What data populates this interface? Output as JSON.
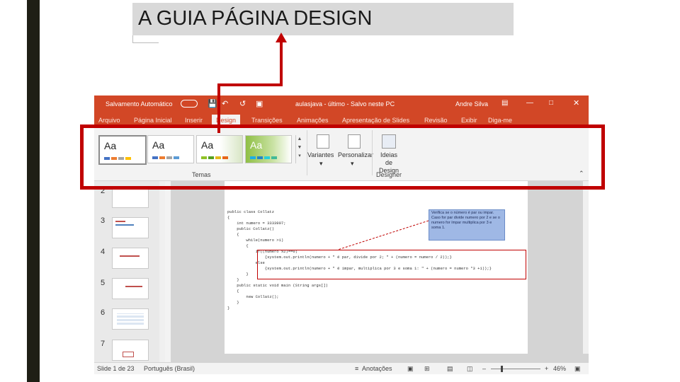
{
  "heading": {
    "text": "A GUIA PÁGINA DESIGN"
  },
  "powerpoint": {
    "titlebar": {
      "autosave": "Salvamento Automático",
      "filename": "aulasjava - último - Salvo neste PC",
      "user": "Andre Silva"
    },
    "tabs": [
      "Arquivo",
      "Página Inicial",
      "Inserir",
      "Design",
      "Transições",
      "Animações",
      "Apresentação de Slides",
      "Revisão",
      "Exibir",
      "Diga-me"
    ],
    "active_tab": "Design",
    "ribbon": {
      "themes_group_label": "Temas",
      "theme_previews": [
        "Aa",
        "Aa",
        "Aa",
        "Aa"
      ],
      "variants_label": "Variantes",
      "customize_label": "Personalizar",
      "designer_label": "Ideias de Design",
      "designer_group_label": "Designer"
    },
    "thumbnails": [
      "2",
      "3",
      "4",
      "5",
      "6",
      "7"
    ],
    "slide": {
      "code_lines": [
        "public class Collatz",
        "{",
        "    int numero = 3333997;",
        "    public Collatz()",
        "    {",
        "        while(numero >1)",
        "        {",
        "            if((numero %2)==0)",
        "                {system.out.println(numero + \" é par, divide por 2; \" + (numero = numero / 2));}",
        "            else",
        "                {system.out.println(numero + \" é impar, multiplica por 3 e soma 1: \" + (numero = numero *3 +1));}",
        "",
        "        }",
        "    }",
        "    public static void main (String args[])",
        "    {",
        "        new Collatz();",
        "    }",
        "}"
      ],
      "note": "Verifica se o número é par ou impar. Caso for par divide numero por 2 e se o numero for ímpar multiplica por 3 e soma 1."
    },
    "statusbar": {
      "slide_info": "Slide 1 de 23",
      "language": "Português (Brasil)",
      "notes": "Anotações",
      "zoom": "46%"
    }
  },
  "colors": {
    "accent": "#d24726",
    "highlight": "#c00000",
    "title_box": "#d9d9d9",
    "left_bar": "#1f1f15"
  }
}
